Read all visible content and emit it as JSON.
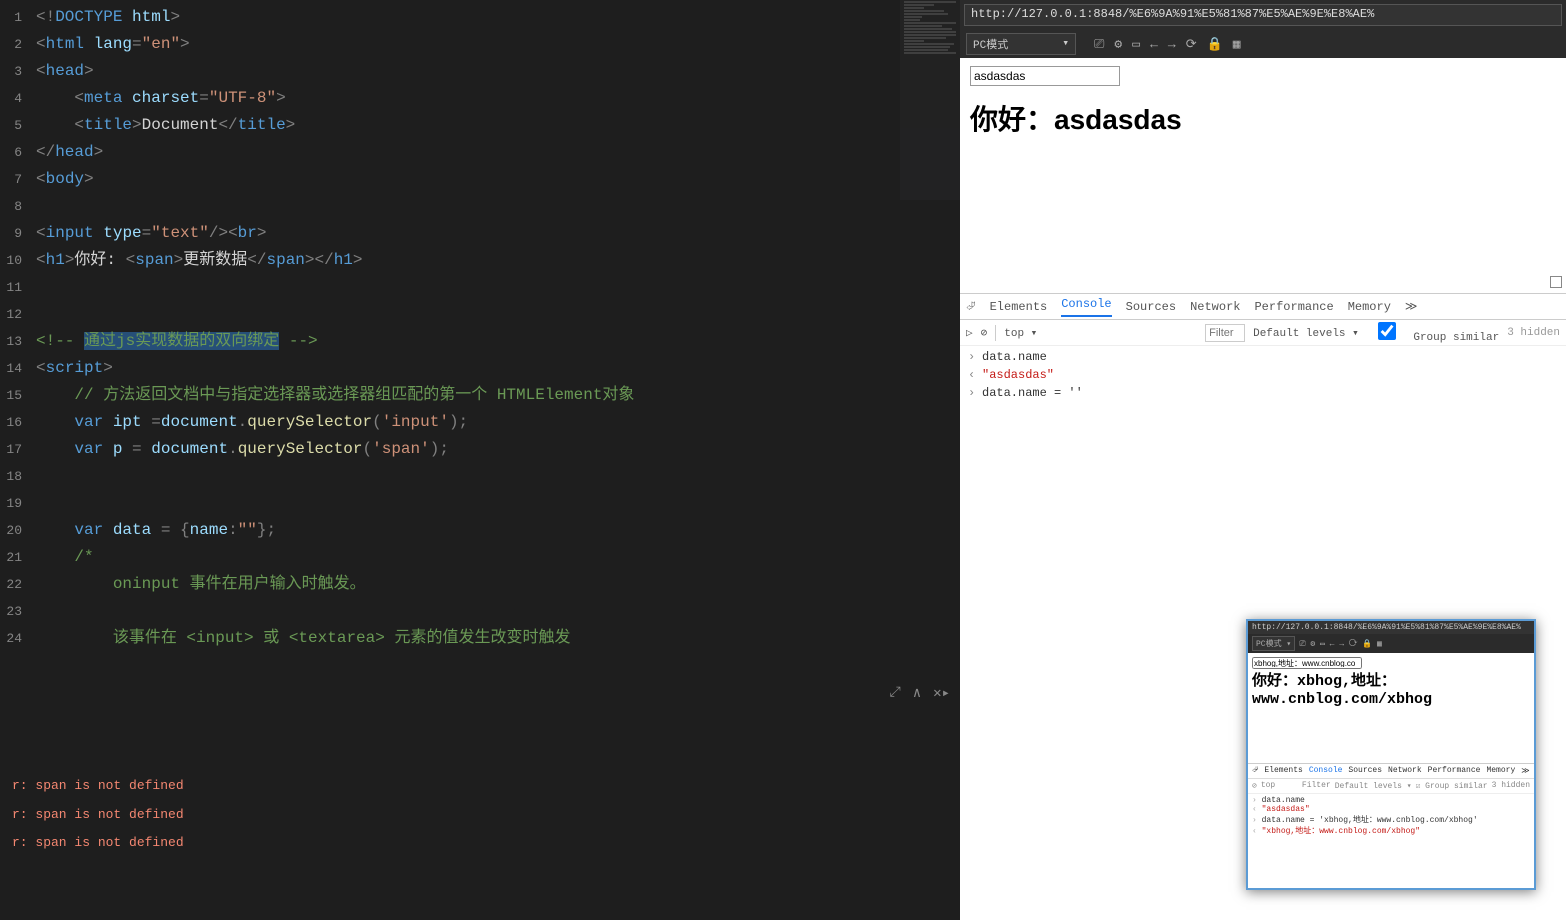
{
  "editor": {
    "line_numbers": [
      "1",
      "2",
      "3",
      "4",
      "5",
      "6",
      "7",
      "8",
      "9",
      "10",
      "11",
      "12",
      "13",
      "14",
      "15",
      "16",
      "17",
      "18",
      "19",
      "20",
      "21",
      "22",
      "23",
      "24"
    ],
    "code_lines": [
      {
        "html": "<span class='t-punc'>&lt;!</span><span class='t-elem'>DOCTYPE</span> <span class='t-attr'>html</span><span class='t-punc'>&gt;</span>"
      },
      {
        "html": "<span class='t-punc'>&lt;</span><span class='t-elem'>html</span> <span class='t-attr'>lang</span><span class='t-punc'>=</span><span class='t-str'>\"en\"</span><span class='t-punc'>&gt;</span>"
      },
      {
        "html": "<span class='t-punc'>&lt;</span><span class='t-elem'>head</span><span class='t-punc'>&gt;</span>",
        "fold": "⊟"
      },
      {
        "html": "    <span class='t-punc'>&lt;</span><span class='t-elem'>meta</span> <span class='t-attr'>charset</span><span class='t-punc'>=</span><span class='t-str'>\"UTF-8\"</span><span class='t-punc'>&gt;</span>"
      },
      {
        "html": "    <span class='t-punc'>&lt;</span><span class='t-elem'>title</span><span class='t-punc'>&gt;</span><span class='t-text'>Document</span><span class='t-punc'>&lt;/</span><span class='t-elem'>title</span><span class='t-punc'>&gt;</span>"
      },
      {
        "html": "<span class='t-punc'>&lt;/</span><span class='t-elem'>head</span><span class='t-punc'>&gt;</span>"
      },
      {
        "html": "<span class='t-punc'>&lt;</span><span class='t-elem'>body</span><span class='t-punc'>&gt;</span>"
      },
      {
        "html": ""
      },
      {
        "html": "<span class='t-punc'>&lt;</span><span class='t-elem'>input</span> <span class='t-attr'>type</span><span class='t-punc'>=</span><span class='t-str'>\"text\"</span><span class='t-punc'>/&gt;&lt;</span><span class='t-elem'>br</span><span class='t-punc'>&gt;</span>"
      },
      {
        "html": "<span class='t-punc'>&lt;</span><span class='t-elem'>h1</span><span class='t-punc'>&gt;</span><span class='t-text'>你好: </span><span class='t-punc'>&lt;</span><span class='t-elem'>span</span><span class='t-punc'>&gt;</span><span class='t-text'>更新数据</span><span class='t-punc'>&lt;/</span><span class='t-elem'>span</span><span class='t-punc'>&gt;&lt;/</span><span class='t-elem'>h1</span><span class='t-punc'>&gt;</span>"
      },
      {
        "html": ""
      },
      {
        "html": ""
      },
      {
        "html": "<span class='t-comment'>&lt;!-- </span><span class='t-comment t-sel'>通过js实现数据的双向绑定</span><span class='t-comment'> --&gt;</span>"
      },
      {
        "html": "<span class='t-punc'>&lt;</span><span class='t-elem'>script</span><span class='t-punc'>&gt;</span>",
        "fold": "⊟"
      },
      {
        "html": "    <span class='t-comment'>// 方法返回文档中与指定选择器或选择器组匹配的第一个 HTMLElement对象</span>"
      },
      {
        "html": "    <span class='t-keyword'>var</span> <span class='t-iden'>ipt</span> <span class='t-punc'>=</span><span class='t-iden'>document</span><span class='t-punc'>.</span><span class='t-call'>querySelector</span><span class='t-punc'>(</span><span class='t-str'>'input'</span><span class='t-punc'>);</span>"
      },
      {
        "html": "    <span class='t-keyword'>var</span> <span class='t-iden'>p</span> <span class='t-punc'>=</span> <span class='t-iden'>document</span><span class='t-punc'>.</span><span class='t-call'>querySelector</span><span class='t-punc'>(</span><span class='t-str'>'span'</span><span class='t-punc'>);</span>"
      },
      {
        "html": ""
      },
      {
        "html": ""
      },
      {
        "html": "    <span class='t-keyword'>var</span> <span class='t-iden'>data</span> <span class='t-punc'>= {</span><span class='t-iden'>name</span><span class='t-punc'>:</span><span class='t-str'>\"\"</span><span class='t-punc'>};</span>"
      },
      {
        "html": "    <span class='t-comment'>/*</span>",
        "fold": "⊟"
      },
      {
        "html": "        <span class='t-comment'>oninput 事件在用户输入时触发。</span>"
      },
      {
        "html": ""
      },
      {
        "html": "        <span class='t-comment'>该事件在 &lt;input&gt; 或 &lt;textarea&gt; 元素的值发生改变时触发</span>"
      }
    ]
  },
  "terminal": {
    "lines": [
      "r: span is not defined",
      "r: span is not defined",
      "r: span is not defined"
    ]
  },
  "browser": {
    "url": "http://127.0.0.1:8848/%E6%9A%91%E5%81%87%E5%AE%9E%E8%AE%",
    "mode": "PC模式",
    "page": {
      "input_value": "asdasdas",
      "heading_prefix": "你好：",
      "heading_span": "asdasdas"
    }
  },
  "devtools": {
    "tabs": [
      "Elements",
      "Console",
      "Sources",
      "Network",
      "Performance",
      "Memory"
    ],
    "active_tab": "Console",
    "more": "≫",
    "filter": {
      "context": "top",
      "placeholder": "Filter",
      "levels": "Default levels ▾",
      "group": "Group similar",
      "hidden": "3 hidden"
    },
    "console": [
      {
        "t": "in",
        "text": "data.name"
      },
      {
        "t": "out",
        "text": "\"asdasdas\"",
        "cls": "c-red"
      },
      {
        "t": "in",
        "text": "data.name = ''"
      }
    ]
  },
  "overlay": {
    "url": "http://127.0.0.1:8848/%E6%9A%91%E5%81%87%E5%AE%9E%E8%AE%",
    "mode": "PC模式",
    "input_value": "xbhog,地址：www.cnblog.co",
    "heading": "你好：xbhog,地址：www.cnblog.com/xbhog",
    "tabs": [
      "Elements",
      "Console",
      "Sources",
      "Network",
      "Performance",
      "Memory"
    ],
    "filter": {
      "context": "top",
      "levels": "Default levels ▾",
      "group": "Group similar",
      "hidden": "3 hidden",
      "placeholder": "Filter"
    },
    "console": [
      {
        "t": "in",
        "text": "data.name"
      },
      {
        "t": "out",
        "text": "\"asdasdas\"",
        "cls": "c-red"
      },
      {
        "t": "in",
        "text": "data.name = 'xbhog,地址：www.cnblog.com/xbhog'"
      },
      {
        "t": "out",
        "text": "\"xbhog,地址：www.cnblog.com/xbhog\"",
        "cls": "c-red"
      }
    ]
  }
}
